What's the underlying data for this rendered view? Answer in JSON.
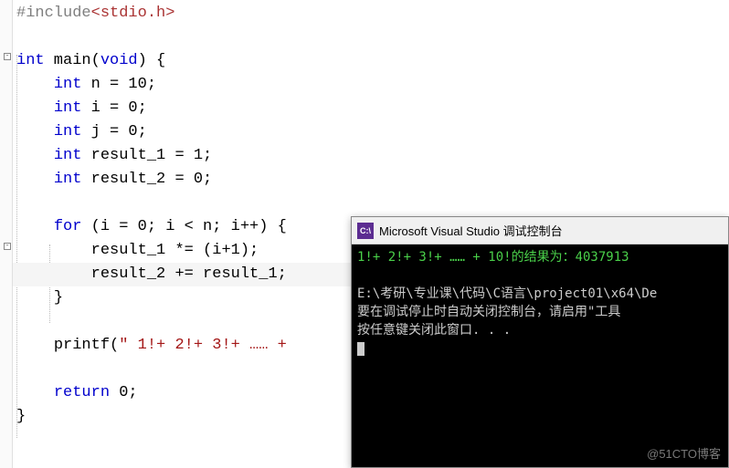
{
  "code": {
    "line1_directive": "#include",
    "line1_header": "<stdio.h>",
    "line3_type": "int",
    "line3_func": " main",
    "line3_void": "void",
    "line3_rest": ") {",
    "line4": "int",
    "line4_rest": " n = 10;",
    "line5": "int",
    "line5_rest": " i = 0;",
    "line6": "int",
    "line6_rest": " j = 0;",
    "line7": "int",
    "line7_rest": " result_1 = 1;",
    "line8": "int",
    "line8_rest": " result_2 = 0;",
    "line10_for": "for",
    "line10_rest": " (i = 0; i < n; i++) {",
    "line11": "result_1 *= (i+1);",
    "line12": "result_2 += result_1;",
    "line13": "}",
    "line15_printf": "printf",
    "line15_string": "\" 1!+ 2!+ 3!+ …… +",
    "line17_return": "return",
    "line17_rest": " 0;",
    "line18": "}"
  },
  "console": {
    "title": "Microsoft Visual Studio 调试控制台",
    "icon_text": "C:\\",
    "output_line1": "1!+ 2!+ 3!+ …… + 10!的结果为：4037913",
    "output_line2_path": "E:\\考研\\专业课\\代码\\C语言\\project01\\x64\\De",
    "output_line3": "要在调试停止时自动关闭控制台，请启用\"工具",
    "output_line4": "按任意键关闭此窗口. . ."
  },
  "watermark": "@51CTO博客"
}
